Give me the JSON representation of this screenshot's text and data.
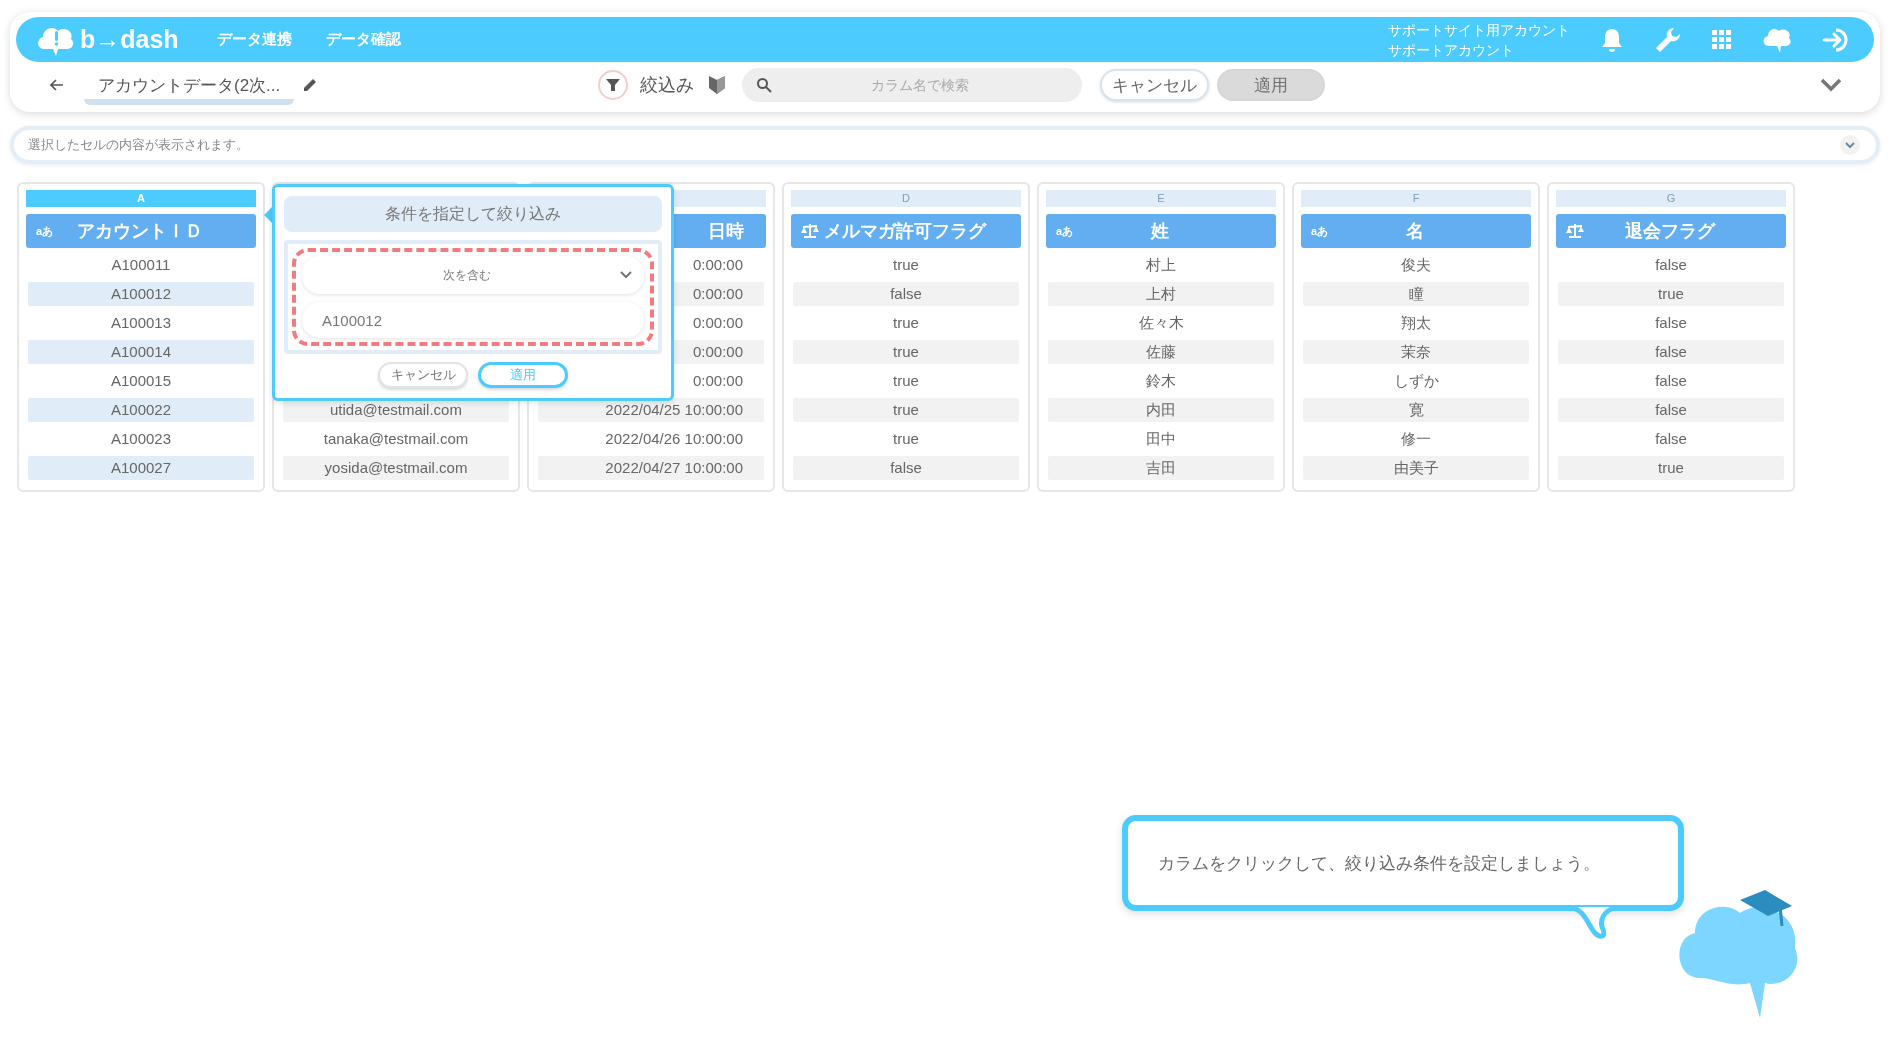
{
  "header": {
    "logo": "b→dash",
    "nav": [
      {
        "label": "データ連携"
      },
      {
        "label": "データ確認"
      }
    ],
    "account": [
      "サポートサイト用アカウント",
      "サポートアカウント"
    ]
  },
  "toolbar": {
    "title": "アカウントデータ(2次...",
    "filter_label": "絞込み",
    "search": {
      "placeholder": "カラム名で検索"
    },
    "buttons": [
      {
        "label": "キャンセル",
        "disabled": false
      },
      {
        "label": "適用",
        "disabled": true
      }
    ]
  },
  "cell_bar": {
    "placeholder": "選択したセルの内容が表示されます。"
  },
  "columns": [
    {
      "letter": "A",
      "kind": "text",
      "type_label": "aあ",
      "title": "アカウントＩＤ",
      "selected": true,
      "cells": [
        {
          "text": "A100011"
        },
        {
          "text": "A100012"
        },
        {
          "text": "A100013"
        },
        {
          "text": "A100014"
        },
        {
          "text": "A100015"
        },
        {
          "text": "A100022"
        },
        {
          "text": "A100023"
        },
        {
          "text": "A100027"
        }
      ]
    },
    {
      "kind": "email",
      "selected": false,
      "cells": [
        {
          "text": "utida@testmail.com"
        },
        {
          "text": "tanaka@testmail.com"
        },
        {
          "text": "yosida@testmail.com"
        }
      ]
    },
    {
      "kind": "date",
      "title": "日時",
      "selected": false,
      "cells": [
        {
          "text": "0:00:00"
        },
        {
          "text": "0:00:00"
        },
        {
          "text": "0:00:00"
        },
        {
          "text": "0:00:00"
        },
        {
          "text": "0:00:00"
        },
        {
          "text": "2022/04/25 10:00:00"
        },
        {
          "text": "2022/04/26 10:00:00"
        },
        {
          "text": "2022/04/27 10:00:00"
        }
      ]
    },
    {
      "letter": "D",
      "kind": "flag",
      "title": "メルマガ許可フラグ",
      "selected": false,
      "cells": [
        {
          "text": "true"
        },
        {
          "text": "false"
        },
        {
          "text": "true"
        },
        {
          "text": "true"
        },
        {
          "text": "true"
        },
        {
          "text": "true"
        },
        {
          "text": "true"
        },
        {
          "text": "false"
        }
      ]
    },
    {
      "letter": "E",
      "kind": "text",
      "type_label": "aあ",
      "title": "姓",
      "selected": false,
      "cells": [
        {
          "text": "村上"
        },
        {
          "text": "上村"
        },
        {
          "text": "佐々木"
        },
        {
          "text": "佐藤"
        },
        {
          "text": "鈴木"
        },
        {
          "text": "内田"
        },
        {
          "text": "田中"
        },
        {
          "text": "吉田"
        }
      ]
    },
    {
      "letter": "F",
      "kind": "text",
      "type_label": "aあ",
      "title": "名",
      "selected": false,
      "cells": [
        {
          "text": "俊夫"
        },
        {
          "text": "瞳"
        },
        {
          "text": "翔太"
        },
        {
          "text": "茉奈"
        },
        {
          "text": "しずか"
        },
        {
          "text": "寛"
        },
        {
          "text": "修一"
        },
        {
          "text": "由美子"
        }
      ]
    },
    {
      "letter": "G",
      "kind": "flag",
      "title": "退会フラグ",
      "selected": false,
      "cells": [
        {
          "text": "false"
        },
        {
          "text": "true"
        },
        {
          "text": "false"
        },
        {
          "text": "false"
        },
        {
          "text": "false"
        },
        {
          "text": "false"
        },
        {
          "text": "false"
        },
        {
          "text": "true"
        }
      ]
    }
  ],
  "filter_popup": {
    "title": "条件を指定して絞り込み",
    "condition": "次を含む",
    "value": "A100012",
    "buttons": [
      {
        "label": "キャンセル",
        "primary": false
      },
      {
        "label": "適用",
        "primary": true
      }
    ]
  },
  "tip": {
    "text": "カラムをクリックして、絞り込み条件を設定しましょう。"
  }
}
